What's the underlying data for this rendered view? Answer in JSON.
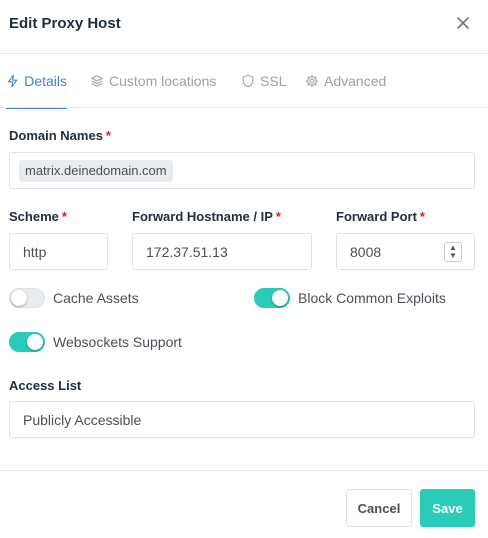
{
  "modal": {
    "title": "Edit Proxy Host"
  },
  "tabs": [
    {
      "label": "Details",
      "icon": "pulse-icon",
      "active": true
    },
    {
      "label": "Custom locations",
      "icon": "layers-icon",
      "active": false
    },
    {
      "label": "SSL",
      "icon": "shield-icon",
      "active": false
    },
    {
      "label": "Advanced",
      "icon": "gear-icon",
      "active": false
    }
  ],
  "form": {
    "domain_names_label": "Domain Names",
    "domain_names": [
      "matrix.deinedomain.com"
    ],
    "scheme_label": "Scheme",
    "scheme_value": "http",
    "hostname_label": "Forward Hostname / IP",
    "hostname_value": "172.37.51.13",
    "port_label": "Forward Port",
    "port_value": "8008",
    "required_mark": "*",
    "cache_assets_label": "Cache Assets",
    "cache_assets": false,
    "block_exploits_label": "Block Common Exploits",
    "block_exploits": true,
    "websockets_label": "Websockets Support",
    "websockets": true,
    "access_list_label": "Access List",
    "access_list_value": "Publicly Accessible"
  },
  "footer": {
    "cancel_label": "Cancel",
    "save_label": "Save"
  },
  "colors": {
    "accent": "#467fcf",
    "toggle_on": "#2bcbba",
    "save_button": "#2bcbba",
    "required": "#cd201f"
  }
}
